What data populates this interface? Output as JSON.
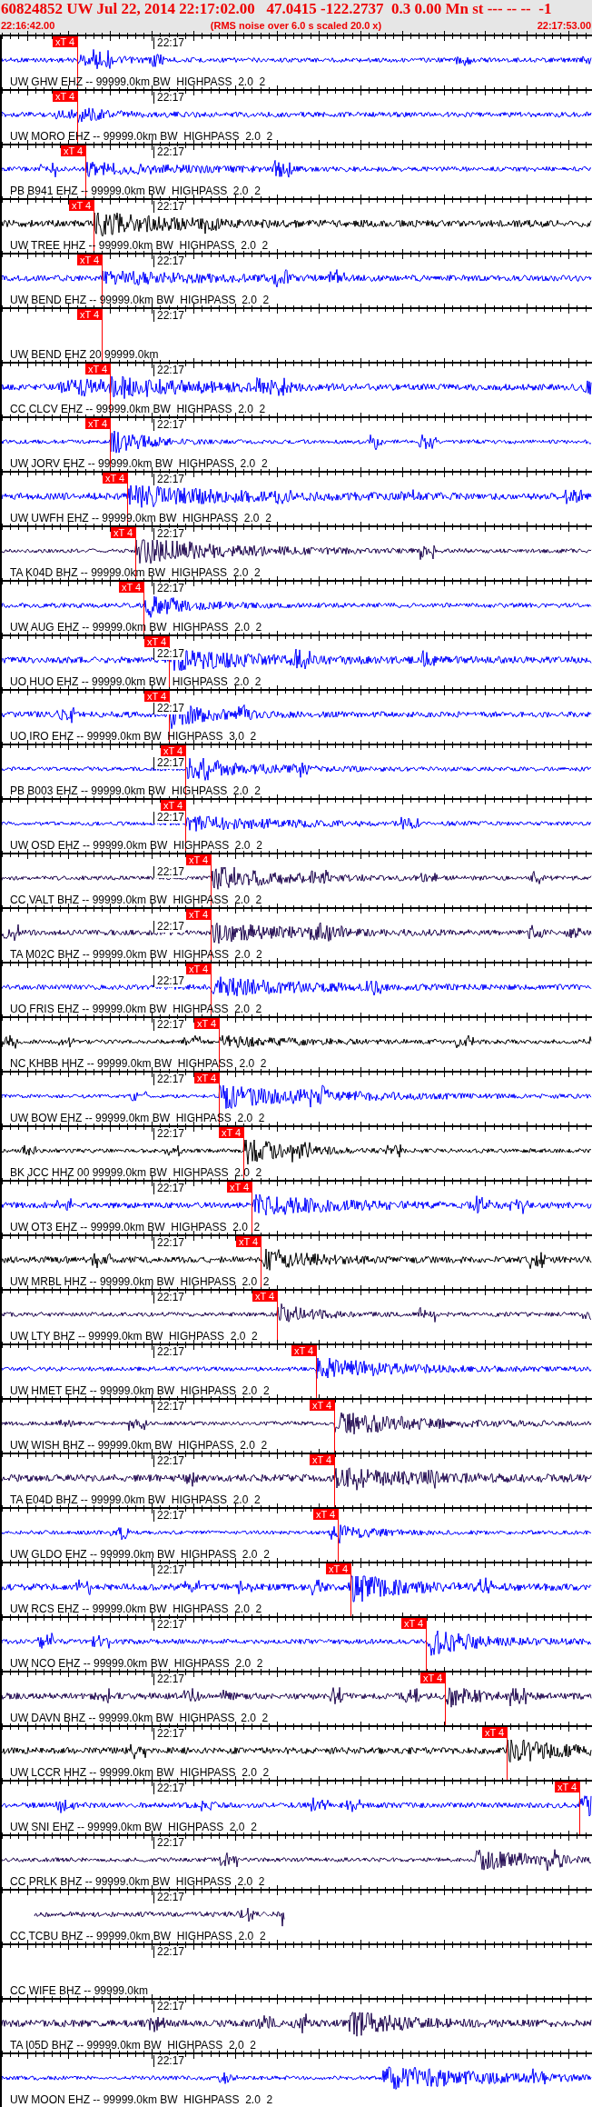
{
  "header": {
    "title": "60824852 UW Jul 22, 2014 22:17:02.00   47.0415 -122.2737  0.3 0.00 Mn st --- -- --  -1",
    "start_time": "22:16:42.00",
    "note": "(RMS noise over 6.0 s scaled 20.0 x)",
    "end_time": "22:17:53.00"
  },
  "traces": [
    {
      "label": "UW GHW EHZ -- 99999.0km BW  HIGHPASS  2.0  2",
      "time_label": "22:17",
      "pick": "xT 4",
      "color": "#0000ff",
      "kind": "full"
    },
    {
      "label": "UW MORO EHZ -- 99999.0km BW  HIGHPASS  2.0  2",
      "time_label": "22:17",
      "pick": "xT 4",
      "color": "#0000ff",
      "kind": "full"
    },
    {
      "label": "PB B941 EHZ -- 99999.0km BW  HIGHPASS  2.0  2",
      "time_label": "22:17",
      "pick": "xT 4",
      "color": "#0000ff",
      "kind": "full"
    },
    {
      "label": "UW TREE HHZ -- 99999.0km BW  HIGHPASS  2.0  2",
      "time_label": "22:17",
      "pick": "xT 4",
      "color": "#000000",
      "kind": "full"
    },
    {
      "label": "UW BEND EHZ -- 99999.0km BW  HIGHPASS  2.0  2",
      "time_label": "22:17",
      "pick": "xT 4",
      "color": "#0000ff",
      "kind": "full"
    },
    {
      "label": "UW BEND EHZ 20 99999.0km",
      "time_label": "22:17",
      "pick": "xT 4",
      "kind": "empty"
    },
    {
      "label": "CC CLCV EHZ -- 99999.0km BW  HIGHPASS  2.0  2",
      "time_label": "22:17",
      "pick": "xT 4",
      "color": "#0000ff",
      "kind": "full"
    },
    {
      "label": "UW JORV EHZ -- 99999.0km BW  HIGHPASS  2.0  2",
      "time_label": "22:17",
      "pick": "xT 4",
      "color": "#0000ff",
      "kind": "full"
    },
    {
      "label": "UW UWFH EHZ -- 99999.0km BW  HIGHPASS  2.0  2",
      "time_label": "22:17",
      "pick": "xT 4",
      "color": "#0000ff",
      "kind": "full"
    },
    {
      "label": "TA K04D BHZ -- 99999.0km BW  HIGHPASS  2.0  2",
      "time_label": "22:17",
      "pick": "xT 4",
      "color": "#200850",
      "kind": "full"
    },
    {
      "label": "UW AUG EHZ -- 99999.0km BW  HIGHPASS  2.0  2",
      "time_label": "22:17",
      "pick": "xT 4",
      "color": "#0000ff",
      "kind": "full"
    },
    {
      "label": "UO HUO EHZ -- 99999.0km BW  HIGHPASS  2.0  2",
      "time_label": "22:17",
      "pick": "xT 4",
      "color": "#0000ff",
      "kind": "full"
    },
    {
      "label": "UO IRO EHZ -- 99999.0km BW  HIGHPASS  3.0  2",
      "time_label": "22:17",
      "pick": "xT 4",
      "color": "#0000ff",
      "kind": "full"
    },
    {
      "label": "PB B003 EHZ -- 99999.0km BW  HIGHPASS  2.0  2",
      "time_label": "22:17",
      "pick": "xT 4",
      "color": "#0000ff",
      "kind": "full"
    },
    {
      "label": "UW OSD EHZ -- 99999.0km BW  HIGHPASS  2.0  2",
      "time_label": "22:17",
      "pick": "xT 4",
      "color": "#0000ff",
      "kind": "full"
    },
    {
      "label": "CC VALT BHZ -- 99999.0km BW  HIGHPASS  2.0  2",
      "time_label": "22:17",
      "pick": "xT 4",
      "color": "#200850",
      "kind": "full"
    },
    {
      "label": "TA M02C BHZ -- 99999.0km BW  HIGHPASS  2.0  2",
      "time_label": "22:17",
      "pick": "xT 4",
      "color": "#200850",
      "kind": "full"
    },
    {
      "label": "UO FRIS EHZ -- 99999.0km BW  HIGHPASS  2.0  2",
      "time_label": "22:17",
      "pick": "xT 4",
      "color": "#0000ff",
      "kind": "full"
    },
    {
      "label": "NC KHBB HHZ -- 99999.0km BW  HIGHPASS  2.0  2",
      "time_label": "22:17",
      "pick": "xT 4",
      "color": "#000000",
      "kind": "full"
    },
    {
      "label": "UW BOW EHZ -- 99999.0km BW  HIGHPASS  2.0  2",
      "time_label": "22:17",
      "pick": "xT 4",
      "color": "#0000ff",
      "kind": "full"
    },
    {
      "label": "BK JCC HHZ 00 99999.0km BW  HIGHPASS  2.0  2",
      "time_label": "22:17",
      "pick": "xT 4",
      "color": "#000000",
      "kind": "full"
    },
    {
      "label": "UW OT3 EHZ -- 99999.0km BW  HIGHPASS  2.0  2",
      "time_label": "22:17",
      "pick": "xT 4",
      "color": "#0000ff",
      "kind": "full"
    },
    {
      "label": "UW MRBL HHZ -- 99999.0km BW  HIGHPASS  2.0  2",
      "time_label": "22:17",
      "pick": "xT 4",
      "color": "#000000",
      "kind": "full"
    },
    {
      "label": "UW LTY BHZ -- 99999.0km BW  HIGHPASS  2.0  2",
      "time_label": "22:17",
      "pick": "xT 4",
      "color": "#200850",
      "kind": "full"
    },
    {
      "label": "UW HMET EHZ -- 99999.0km BW  HIGHPASS  2.0  2",
      "time_label": "22:17",
      "pick": "xT 4",
      "color": "#0000ff",
      "kind": "full"
    },
    {
      "label": "UW WISH BHZ -- 99999.0km BW  HIGHPASS  2.0  2",
      "time_label": "22:17",
      "pick": "xT 4",
      "color": "#200850",
      "kind": "full"
    },
    {
      "label": "TA E04D BHZ -- 99999.0km BW  HIGHPASS  2.0  2",
      "time_label": "22:17",
      "pick": "xT 4",
      "color": "#200850",
      "kind": "full"
    },
    {
      "label": "UW GLDO EHZ -- 99999.0km BW  HIGHPASS  2.0  2",
      "time_label": "22:17",
      "pick": "xT 4",
      "color": "#0000ff",
      "kind": "full"
    },
    {
      "label": "UW RCS EHZ -- 99999.0km BW  HIGHPASS  2.0  2",
      "time_label": "22:17",
      "pick": "xT 4",
      "color": "#0000ff",
      "kind": "full"
    },
    {
      "label": "UW NCO EHZ -- 99999.0km BW  HIGHPASS  2.0  2",
      "time_label": "22:17",
      "pick": "xT 4",
      "color": "#0000ff",
      "kind": "full"
    },
    {
      "label": "UW DAVN BHZ -- 99999.0km BW  HIGHPASS  2.0  2",
      "time_label": "22:17",
      "pick": "xT 4",
      "color": "#200850",
      "kind": "full"
    },
    {
      "label": "UW LCCR HHZ -- 99999.0km BW  HIGHPASS  2.0  2",
      "time_label": "22:17",
      "pick": "xT 4",
      "color": "#000000",
      "kind": "full"
    },
    {
      "label": "UW SNI EHZ -- 99999.0km BW  HIGHPASS  2.0  2",
      "time_label": "22:17",
      "pick": "xT 4",
      "color": "#0000ff",
      "kind": "full"
    },
    {
      "label": "CC PRLK BHZ -- 99999.0km BW  HIGHPASS  2.0  2",
      "time_label": "22:17",
      "color": "#200850",
      "kind": "full"
    },
    {
      "label": "CC TCBU BHZ -- 99999.0km BW  HIGHPASS  2.0  2",
      "time_label": "22:17",
      "color": "#200850",
      "kind": "partial"
    },
    {
      "label": "CC WIFE BHZ -- 99999.0km",
      "time_label": "22:17",
      "kind": "empty"
    },
    {
      "label": "TA I05D BHZ -- 99999.0km BW  HIGHPASS  2.0  2",
      "time_label": "22:17",
      "color": "#200850",
      "kind": "full"
    },
    {
      "label": "UW MOON EHZ -- 99999.0km BW  HIGHPASS  2.0  2",
      "time_label": "22:17",
      "color": "#0000ff",
      "kind": "full"
    }
  ]
}
